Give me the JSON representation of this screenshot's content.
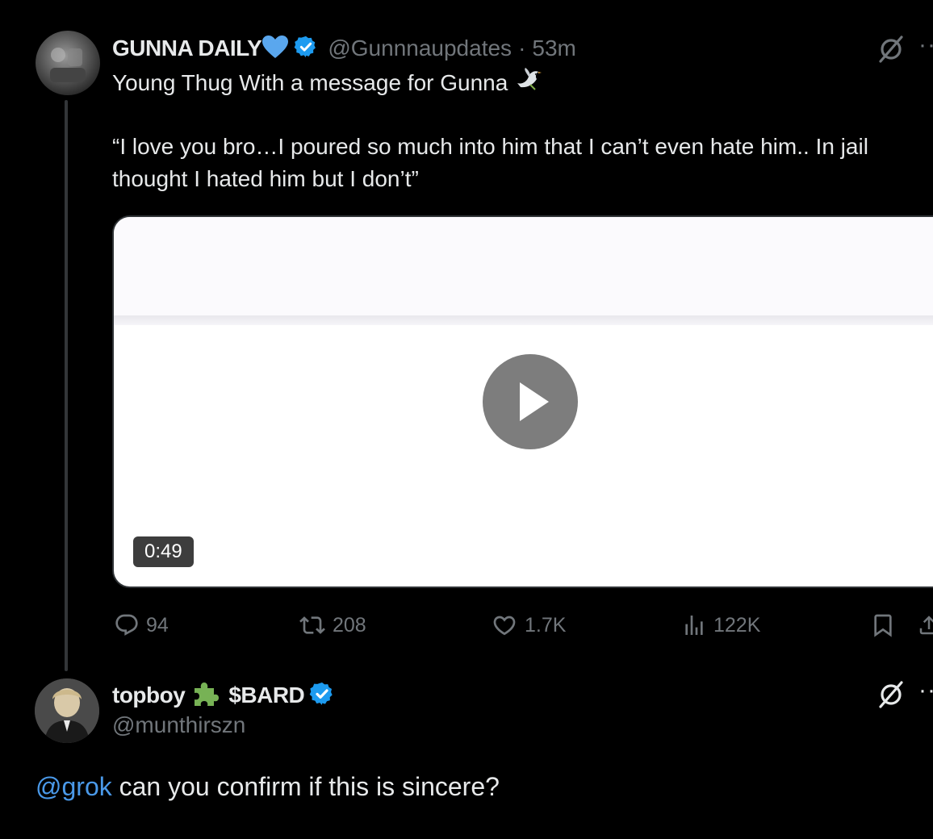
{
  "post": {
    "author_name": "GUNNA DAILY",
    "handle": "@Gunnnaupdates",
    "separator": "·",
    "time": "53m",
    "text_line1": "Young Thug With a message for Gunna",
    "text_line2": "“I love you bro…I poured so much into him that I can’t even hate him.. In jail",
    "text_line3": "thought I hated him but I don’t”",
    "video_duration": "0:49",
    "stats": {
      "replies": "94",
      "reposts": "208",
      "likes": "1.7K",
      "views": "122K"
    }
  },
  "reply": {
    "author_name": "topboy",
    "author_suffix": "$BARD",
    "handle": "@munthirszn",
    "mention": "@grok",
    "text": "can you confirm if this is sincere?"
  },
  "icons": [
    "grok-icon",
    "more-icon",
    "verified-badge-icon",
    "blue-heart-icon",
    "dove-icon",
    "puzzle-icon",
    "reply-icon",
    "repost-icon",
    "like-icon",
    "views-icon",
    "bookmark-icon",
    "share-icon",
    "play-icon"
  ],
  "colors": {
    "background": "#000000",
    "text": "#e7e9ea",
    "secondary": "#71767b",
    "link": "#4a99e9",
    "verified": "#1d9bf0"
  }
}
